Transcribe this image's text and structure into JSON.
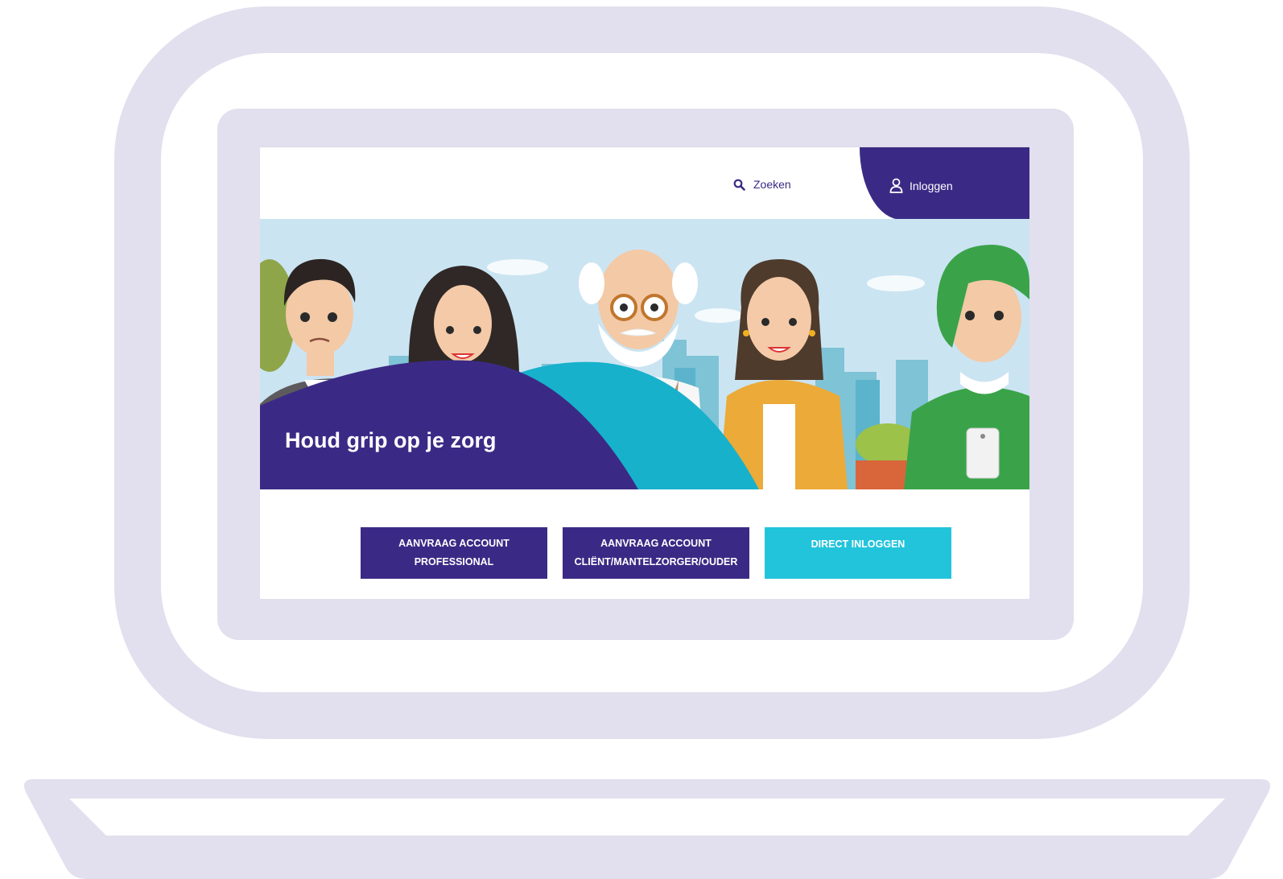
{
  "header": {
    "search_label": "Zoeken",
    "login_label": "Inloggen"
  },
  "hero": {
    "title": "Houd grip op je zorg"
  },
  "actions": {
    "professional_label": "AANVRAAG ACCOUNT PROFESSIONAL",
    "client_label": "AANVRAAG ACCOUNT CLIËNT/MANTELZORGER/OUDER",
    "direct_label": "DIRECT INLOGGEN"
  },
  "colors": {
    "primary": "#3b2a85",
    "accent": "#22c4dc",
    "frame": "#e2dfee"
  },
  "icons": {
    "search": "search-icon",
    "user": "user-icon"
  }
}
